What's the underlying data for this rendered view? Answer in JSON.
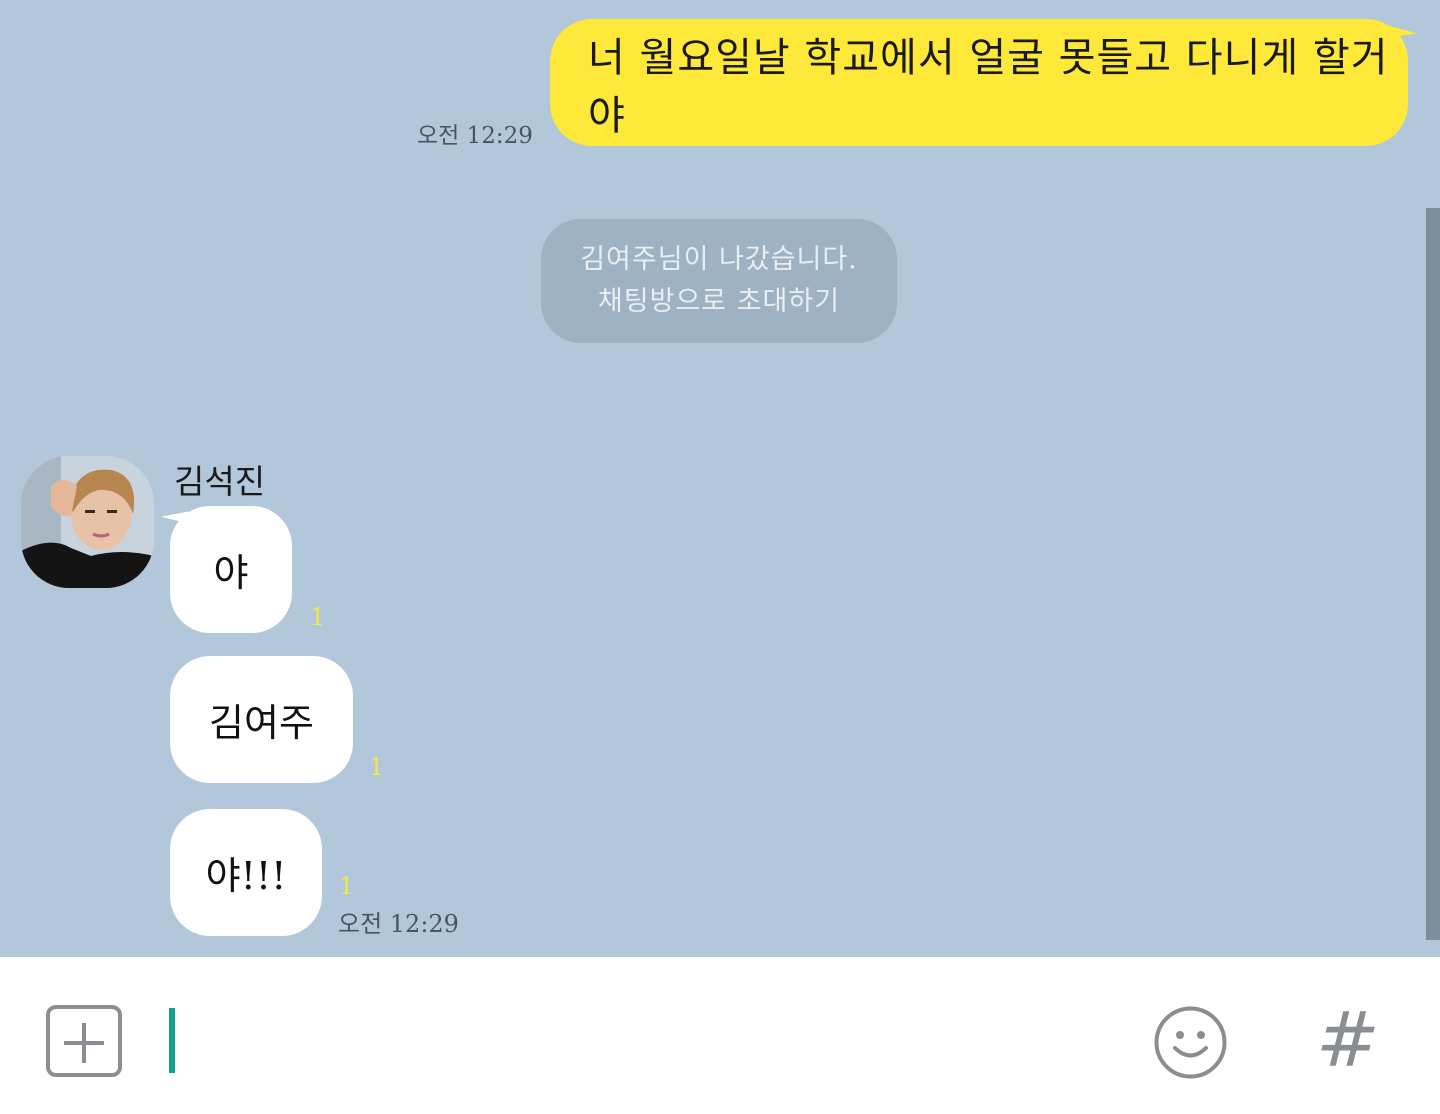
{
  "colors": {
    "chat_background": "#b2c7da",
    "outgoing_bubble": "#fee93a",
    "incoming_bubble": "#ffffff",
    "notice_bubble": "#9fb2c3",
    "unread_count": "#f1e84b",
    "cursor": "#14a08e",
    "input_icons": "#8a8e92"
  },
  "outgoing": {
    "text": "너 월요일날 학교에서 얼굴 못들고 다니게 할거야",
    "time": "오전 12:29"
  },
  "notice": {
    "line1": "김여주님이 나갔습니다.",
    "line2": "채팅방으로 초대하기"
  },
  "incoming": {
    "sender": "김석진",
    "messages": [
      {
        "text": "야",
        "unread": "1"
      },
      {
        "text": "김여주",
        "unread": "1"
      },
      {
        "text": "야!!!",
        "unread": "1"
      }
    ],
    "time": "오전 12:29"
  },
  "input_bar": {
    "plus_icon": "plus-icon",
    "emoji_icon": "smiley-icon",
    "hash_label": "#",
    "input_value": ""
  }
}
